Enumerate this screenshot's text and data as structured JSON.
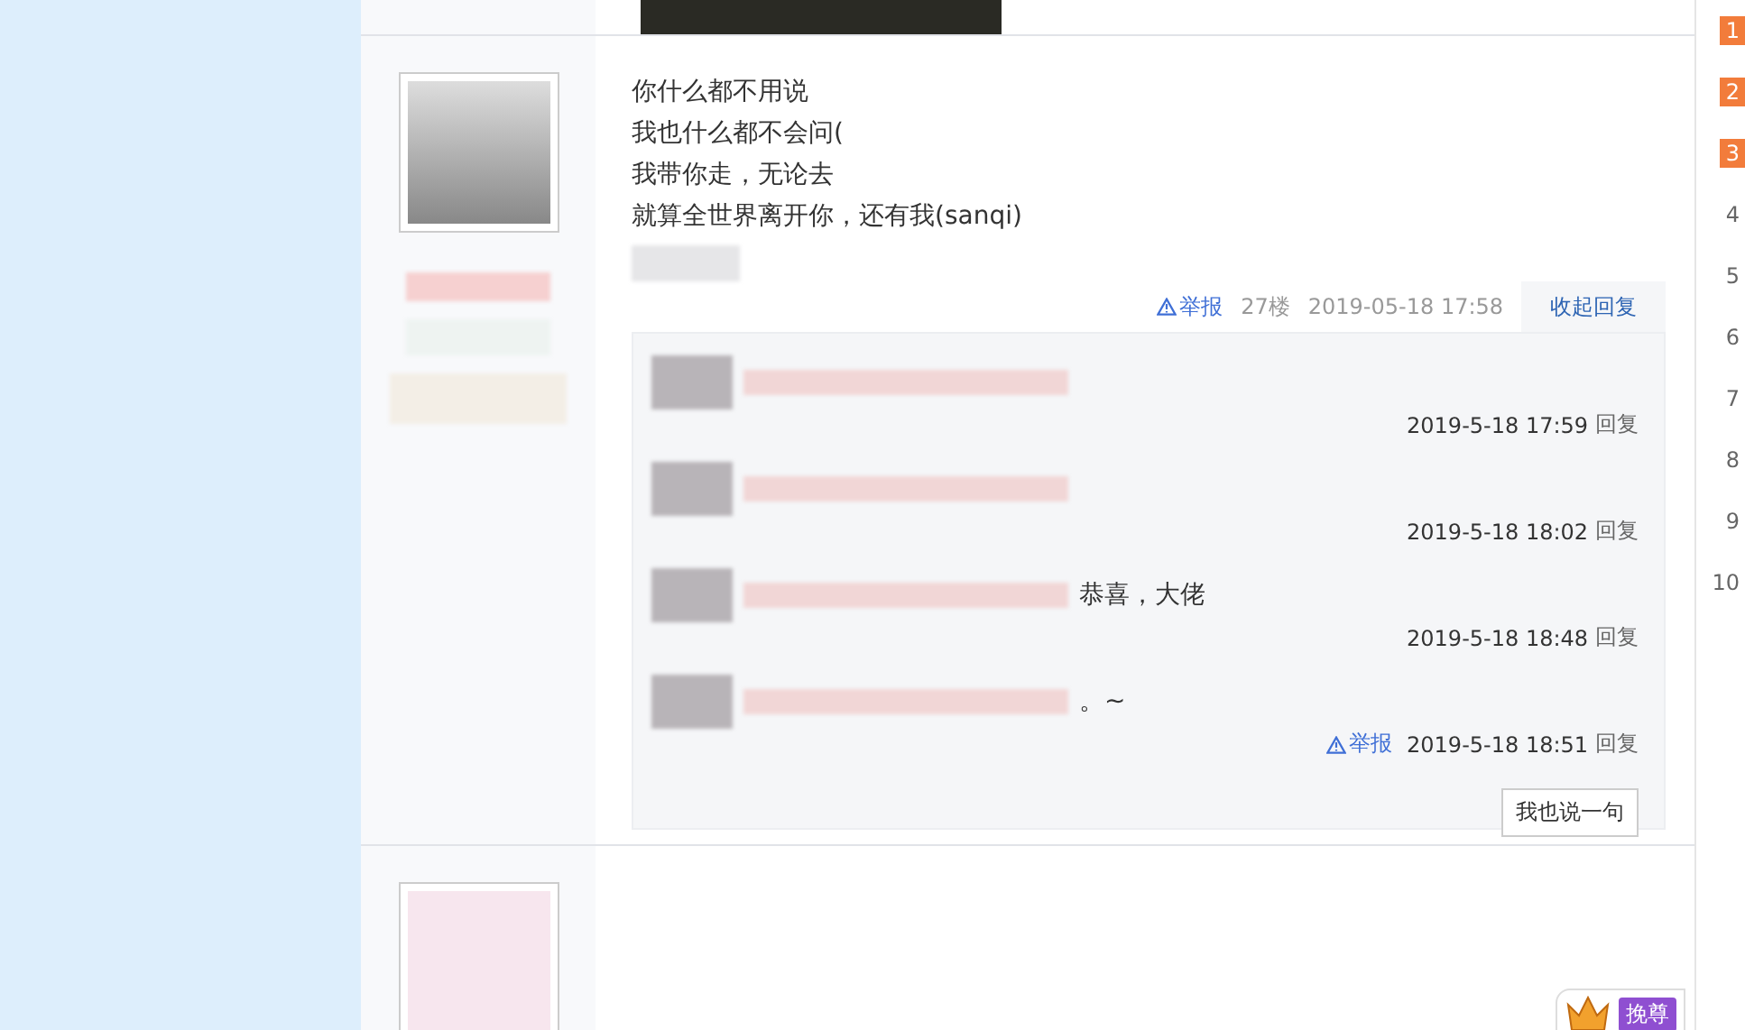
{
  "post": {
    "lines": [
      "你什么都不用说",
      "我也什么都不会问(",
      "我带你走，无论去",
      "就算全世界离开你，还有我(sanqi)"
    ],
    "footer": {
      "report": "举报",
      "floor": "27楼",
      "time": "2019-05-18 17:58",
      "collapse": "收起回复"
    }
  },
  "replies": [
    {
      "time": "2019-5-18 17:59",
      "reply": "回复"
    },
    {
      "time": "2019-5-18 18:02",
      "reply": "回复"
    },
    {
      "text": "恭喜，大佬",
      "time": "2019-5-18 18:48",
      "reply": "回复"
    },
    {
      "text": "。~",
      "time": "2019-5-18 18:51",
      "reply": "回复",
      "report": "举报"
    }
  ],
  "reply_button": "我也说一句",
  "ranking": [
    {
      "label": "1",
      "top": true
    },
    {
      "label": "2",
      "top": true
    },
    {
      "label": "3",
      "top": true
    },
    {
      "label": "4",
      "top": false
    },
    {
      "label": "5",
      "top": false
    },
    {
      "label": "6",
      "top": false
    },
    {
      "label": "7",
      "top": false
    },
    {
      "label": "8",
      "top": false
    },
    {
      "label": "9",
      "top": false
    },
    {
      "label": "10",
      "top": false
    }
  ],
  "badge": "挽尊"
}
